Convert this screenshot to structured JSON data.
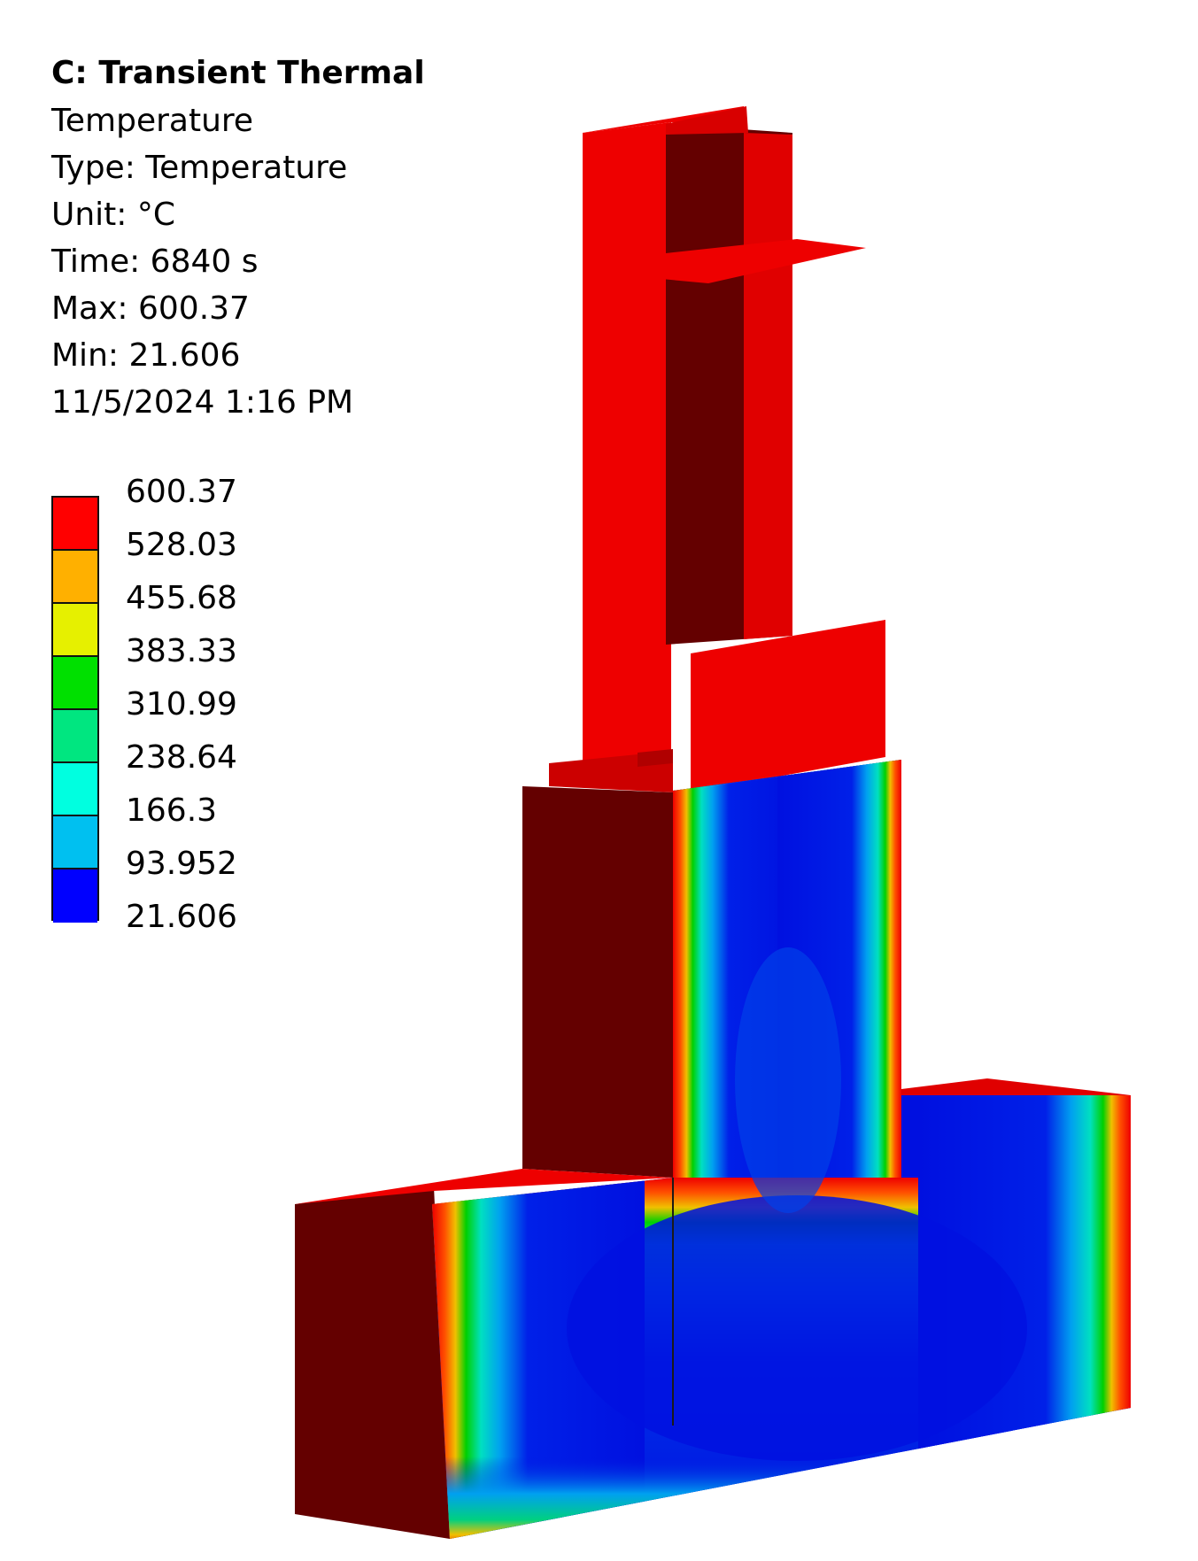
{
  "header": {
    "title": "C: Transient Thermal",
    "result_name": "Temperature",
    "type_line": "Type: Temperature",
    "unit_line": "Unit: °C",
    "time_line": "Time: 6840 s",
    "max_line": "Max: 600.37",
    "min_line": "Min: 21.606",
    "timestamp": "11/5/2024 1:16 PM"
  },
  "legend": {
    "levels": [
      "600.37",
      "528.03",
      "455.68",
      "383.33",
      "310.99",
      "238.64",
      "166.3",
      "93.952",
      "21.606"
    ],
    "bands": [
      {
        "color": "#ff0000",
        "range": "528.03 - 600.37"
      },
      {
        "color": "#ffb000",
        "range": "455.68 - 528.03"
      },
      {
        "color": "#e6f000",
        "range": "383.33 - 455.68"
      },
      {
        "color": "#00e000",
        "range": "310.99 - 383.33"
      },
      {
        "color": "#00e680",
        "range": "238.64 - 310.99"
      },
      {
        "color": "#00ffe0",
        "range": "166.3 - 238.64"
      },
      {
        "color": "#00c0f0",
        "range": "93.952 - 166.3"
      },
      {
        "color": "#0000ff",
        "range": "21.606 - 93.952"
      }
    ]
  },
  "model": {
    "max_color": "#ee0000",
    "shadow_color": "#640000",
    "min_color": "#0010e0"
  }
}
